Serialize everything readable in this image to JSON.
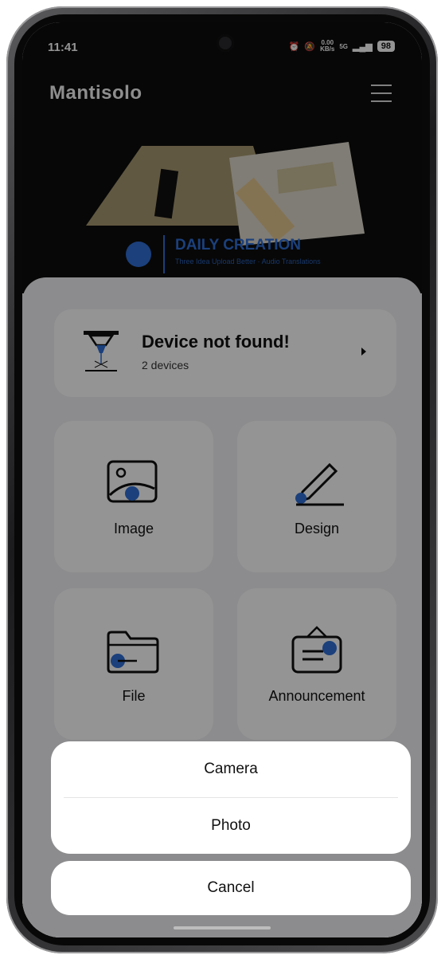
{
  "status_bar": {
    "time": "11:41",
    "net_speed_top": "0.00",
    "net_speed_bottom": "KB/s",
    "signal": "5G",
    "battery": "98"
  },
  "header": {
    "brand": "Mantisolo",
    "banner_title": "DAILY CREATION",
    "banner_subtitle": "Three Idea Upload Better · Audio Translations"
  },
  "device_card": {
    "title": "Device not found!",
    "subtitle": "2 devices"
  },
  "tiles": [
    {
      "label": "Image"
    },
    {
      "label": "Design"
    },
    {
      "label": "File"
    },
    {
      "label": "Announcement"
    }
  ],
  "action_sheet": {
    "camera": "Camera",
    "photo": "Photo",
    "cancel": "Cancel"
  },
  "colors": {
    "accent": "#2f6fd6",
    "overlay": "rgba(0,0,0,0.42)"
  }
}
